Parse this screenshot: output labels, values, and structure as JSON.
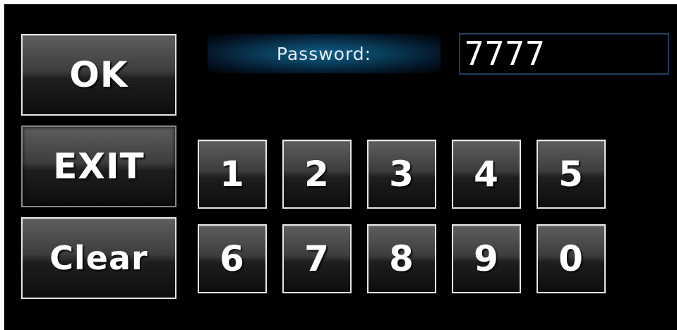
{
  "buttons": {
    "ok": "OK",
    "exit": "EXIT",
    "clear": "Clear"
  },
  "password": {
    "label": "Password:",
    "value": "7777"
  },
  "keypad": {
    "row1": [
      "1",
      "2",
      "3",
      "4",
      "5"
    ],
    "row2": [
      "6",
      "7",
      "8",
      "9",
      "0"
    ]
  },
  "colors": {
    "background": "#000000",
    "button_border": "#e6e6e6",
    "label_glow": "#0e5f8a",
    "input_border": "#1d3f64"
  }
}
